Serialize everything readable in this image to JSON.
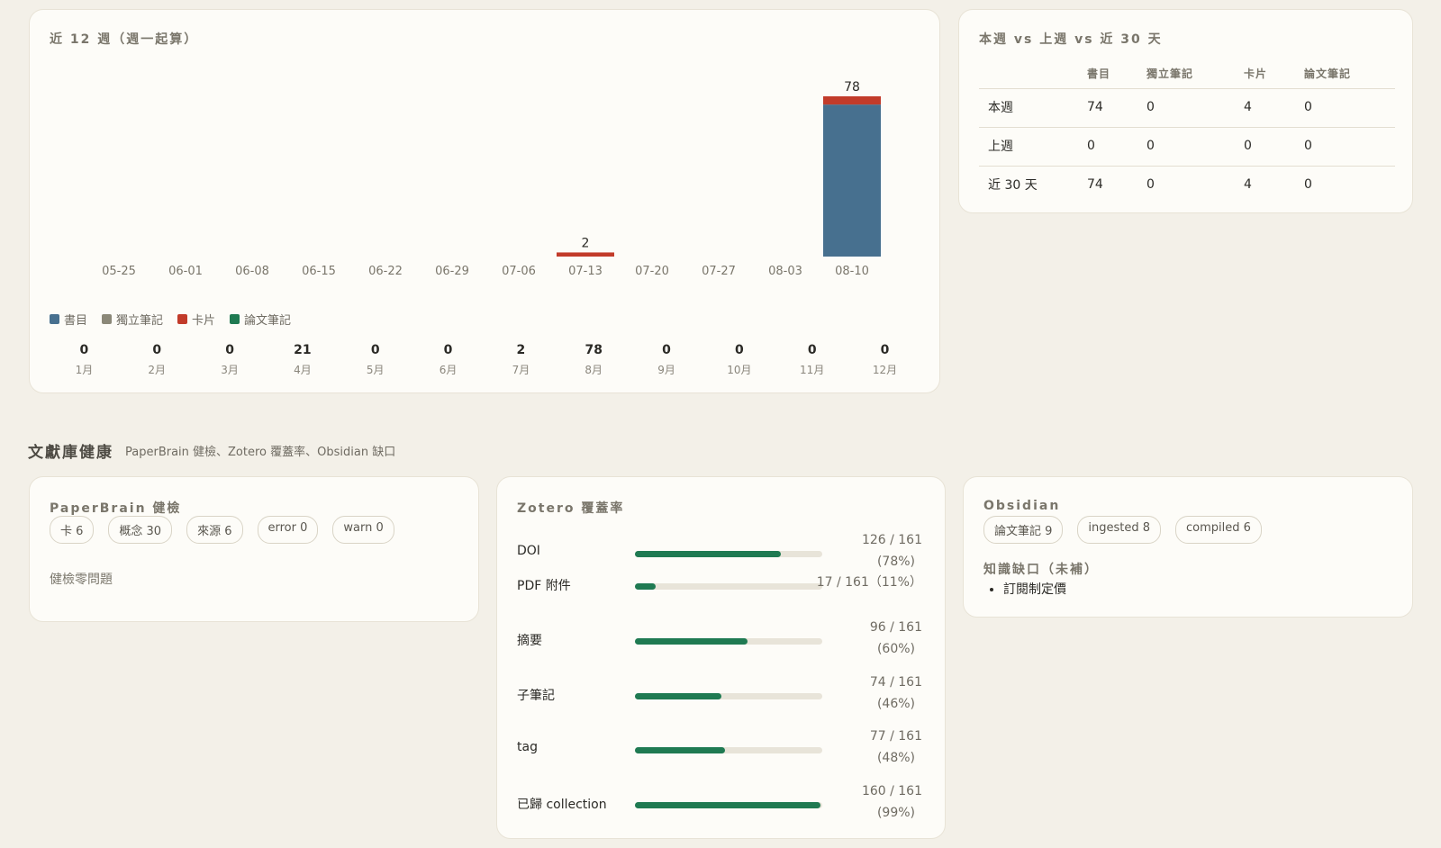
{
  "weekly": {
    "title": "近 12 週（週一起算）",
    "legend": [
      {
        "label": "書目",
        "color": "#47708f"
      },
      {
        "label": "獨立筆記",
        "color": "#8b8878"
      },
      {
        "label": "卡片",
        "color": "#c23b2a"
      },
      {
        "label": "論文筆記",
        "color": "#1f7a52"
      }
    ],
    "months": [
      {
        "value": "0",
        "label": "1月"
      },
      {
        "value": "0",
        "label": "2月"
      },
      {
        "value": "0",
        "label": "3月"
      },
      {
        "value": "21",
        "label": "4月"
      },
      {
        "value": "0",
        "label": "5月"
      },
      {
        "value": "0",
        "label": "6月"
      },
      {
        "value": "2",
        "label": "7月"
      },
      {
        "value": "78",
        "label": "8月"
      },
      {
        "value": "0",
        "label": "9月"
      },
      {
        "value": "0",
        "label": "10月"
      },
      {
        "value": "0",
        "label": "11月"
      },
      {
        "value": "0",
        "label": "12月"
      }
    ]
  },
  "chart_data": {
    "type": "bar",
    "stacked": true,
    "categories": [
      "05-25",
      "06-01",
      "06-08",
      "06-15",
      "06-22",
      "06-29",
      "07-06",
      "07-13",
      "07-20",
      "07-27",
      "08-03",
      "08-10"
    ],
    "series": [
      {
        "name": "書目",
        "color": "#47708f",
        "values": [
          0,
          0,
          0,
          0,
          0,
          0,
          0,
          0,
          0,
          0,
          0,
          74
        ]
      },
      {
        "name": "獨立筆記",
        "color": "#8b8878",
        "values": [
          0,
          0,
          0,
          0,
          0,
          0,
          0,
          0,
          0,
          0,
          0,
          0
        ]
      },
      {
        "name": "卡片",
        "color": "#c23b2a",
        "values": [
          0,
          0,
          0,
          0,
          0,
          0,
          0,
          2,
          0,
          0,
          0,
          4
        ]
      },
      {
        "name": "論文筆記",
        "color": "#1f7a52",
        "values": [
          0,
          0,
          0,
          0,
          0,
          0,
          0,
          0,
          0,
          0,
          0,
          0
        ]
      }
    ],
    "totals": [
      "",
      "",
      "",
      "",
      "",
      "",
      "",
      "2",
      "",
      "",
      "",
      "78"
    ],
    "ylim": [
      0,
      78
    ],
    "grid": false,
    "legend_position": "bottom-left"
  },
  "compare": {
    "title": "本週 vs 上週 vs 近 30 天",
    "headers": [
      "",
      "書目",
      "獨立筆記",
      "卡片",
      "論文筆記"
    ],
    "rows": [
      [
        "本週",
        "74",
        "0",
        "4",
        "0"
      ],
      [
        "上週",
        "0",
        "0",
        "0",
        "0"
      ],
      [
        "近 30 天",
        "74",
        "0",
        "4",
        "0"
      ]
    ]
  },
  "section": {
    "title": "文獻庫健康",
    "subtitle": "PaperBrain 健檢、Zotero 覆蓋率、Obsidian 缺口"
  },
  "paperbrain": {
    "title": "PaperBrain 健檢",
    "chips": [
      "卡 6",
      "概念 30",
      "來源 6",
      "error 0",
      "warn 0"
    ],
    "status": "健檢零問題"
  },
  "zotero": {
    "title": "Zotero 覆蓋率",
    "rows": [
      {
        "label": "DOI",
        "ratio": 0.78,
        "line1": "126 / 161",
        "line2": "(78%)"
      },
      {
        "label": "PDF 附件",
        "ratio": 0.11,
        "line1": "17 / 161（11%）",
        "line2": ""
      },
      {
        "label": "摘要",
        "ratio": 0.6,
        "line1": "96 / 161",
        "line2": "(60%)"
      },
      {
        "label": "子筆記",
        "ratio": 0.46,
        "line1": "74 / 161",
        "line2": "(46%)"
      },
      {
        "label": "tag",
        "ratio": 0.48,
        "line1": "77 / 161",
        "line2": "(48%)"
      },
      {
        "label": "已歸 collection",
        "ratio": 0.99,
        "line1": "160 / 161",
        "line2": "(99%)"
      }
    ]
  },
  "obsidian": {
    "title": "Obsidian",
    "chips": [
      "論文筆記 9",
      "ingested 8",
      "compiled 6"
    ],
    "gap_title": "知識缺口（未補）",
    "gaps": [
      "訂閱制定價"
    ]
  }
}
